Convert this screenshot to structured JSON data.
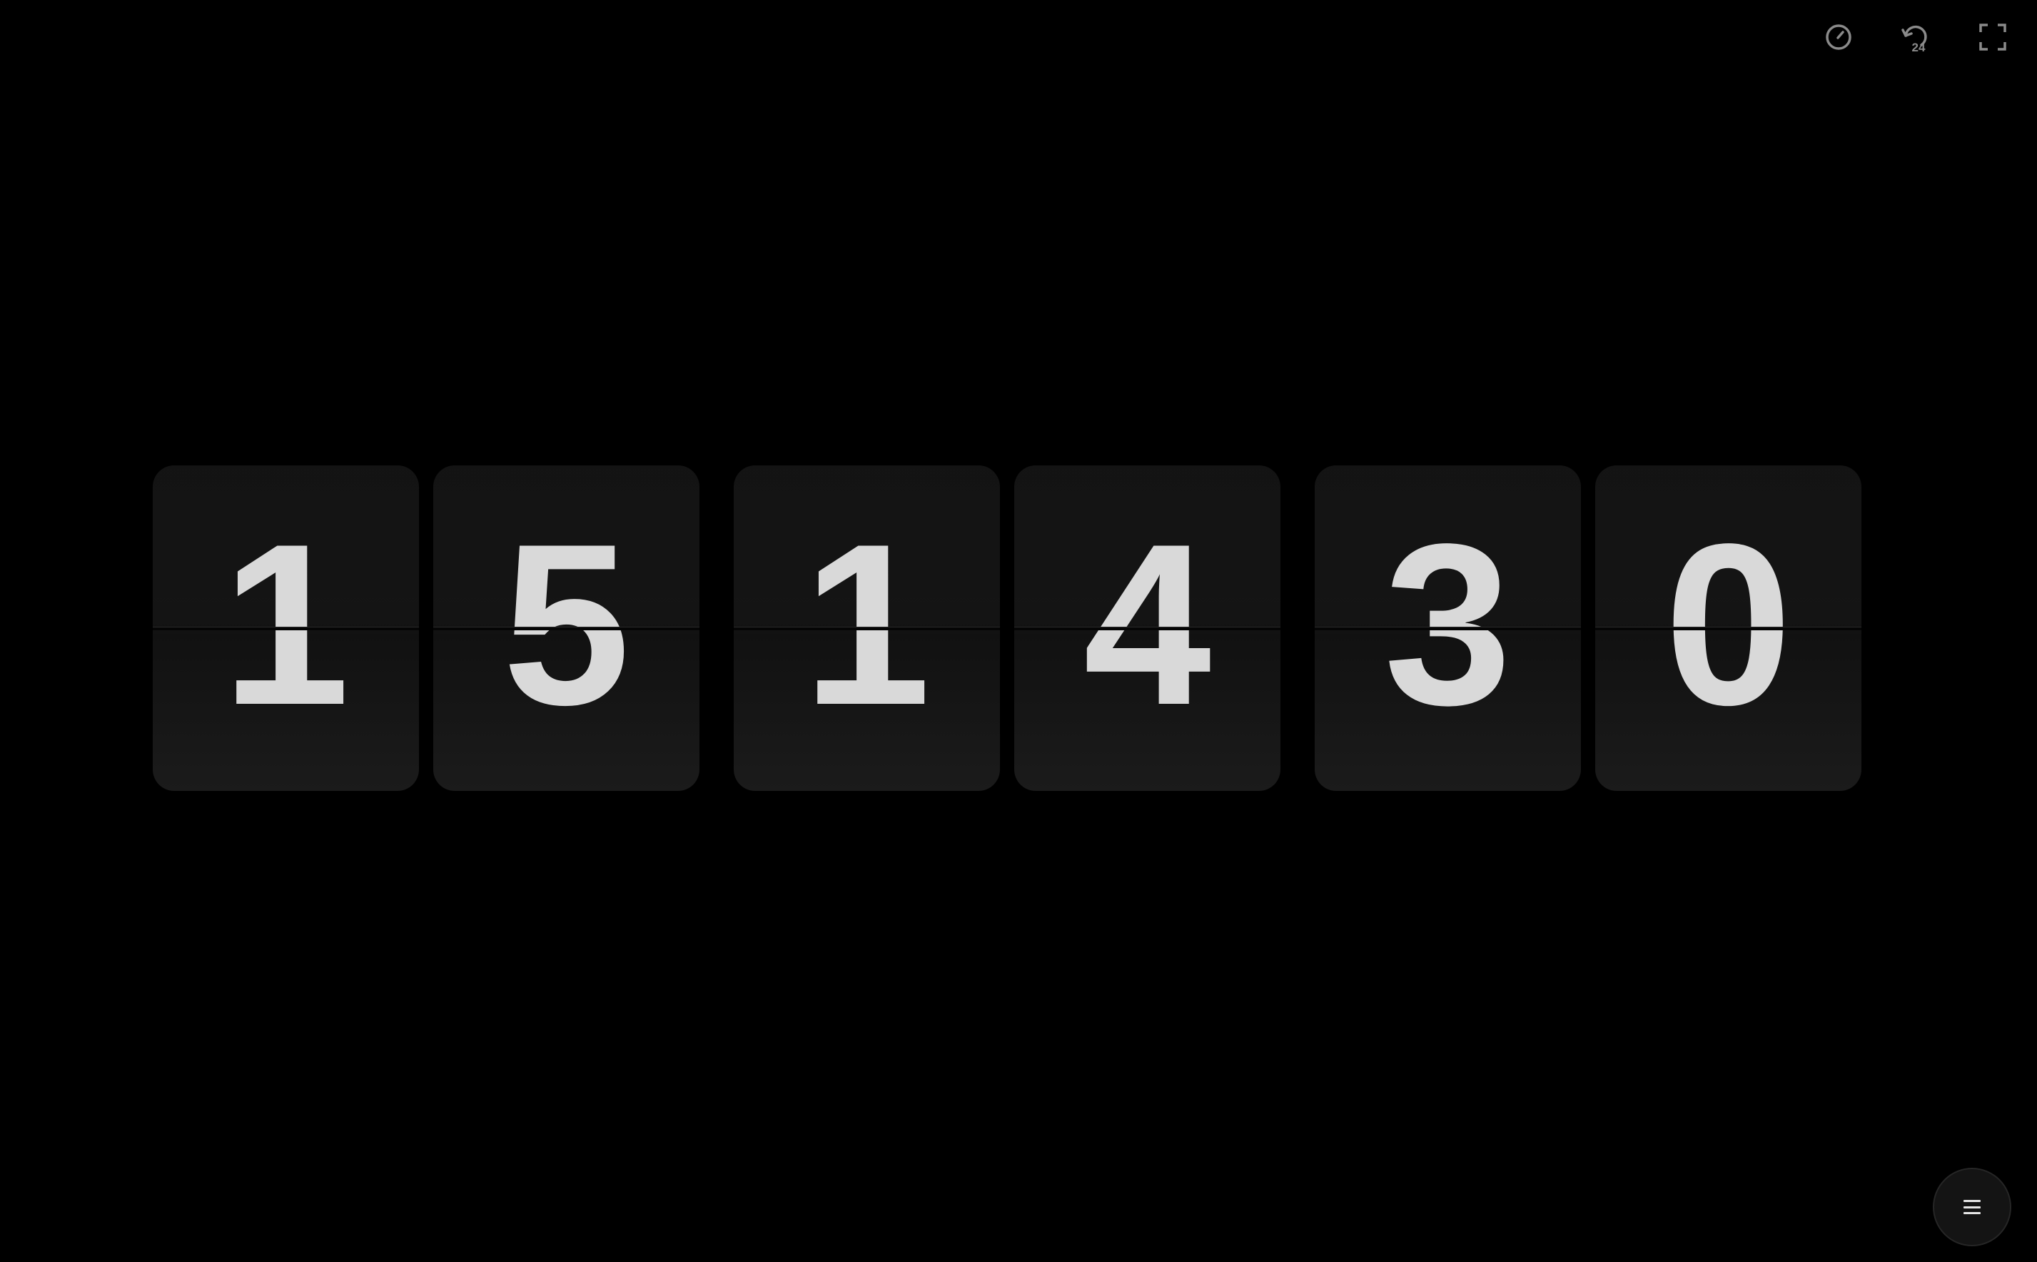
{
  "toolbar": {
    "items": [
      {
        "icon": "speedometer-icon"
      },
      {
        "icon": "24-hour-icon",
        "label": "24"
      },
      {
        "icon": "fullscreen-icon"
      }
    ],
    "icon_color": "#8a8a8a"
  },
  "clock": {
    "hours": [
      "1",
      "5"
    ],
    "minutes": [
      "1",
      "4"
    ],
    "seconds": [
      "3",
      "0"
    ],
    "digit_color": "#d9d9d9",
    "card_color": "#161616"
  },
  "menu": {
    "icon": "hamburger-menu-icon"
  },
  "background": "#000000"
}
